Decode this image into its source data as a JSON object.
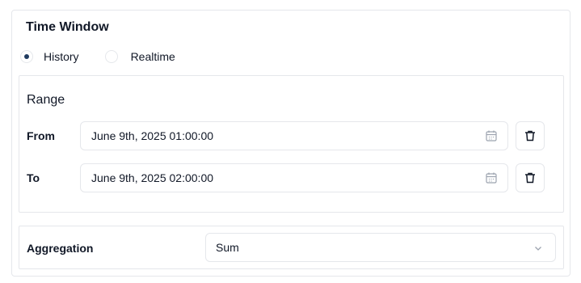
{
  "time_window": {
    "title": "Time Window",
    "mode_options": [
      {
        "label": "History",
        "selected": true
      },
      {
        "label": "Realtime",
        "selected": false
      }
    ]
  },
  "range": {
    "title": "Range",
    "from": {
      "label": "From",
      "value": "June 9th, 2025 01:00:00",
      "icon": "calendar-icon",
      "delete_icon": "trash-icon"
    },
    "to": {
      "label": "To",
      "value": "June 9th, 2025 02:00:00",
      "icon": "calendar-icon",
      "delete_icon": "trash-icon"
    }
  },
  "aggregation": {
    "label": "Aggregation",
    "selected": "Sum",
    "icon": "chevron-down-icon"
  },
  "colors": {
    "border": "#e5e7eb",
    "radio_selected": "#1f3a5f",
    "text": "#111827",
    "icon_muted": "#9ca3af"
  }
}
